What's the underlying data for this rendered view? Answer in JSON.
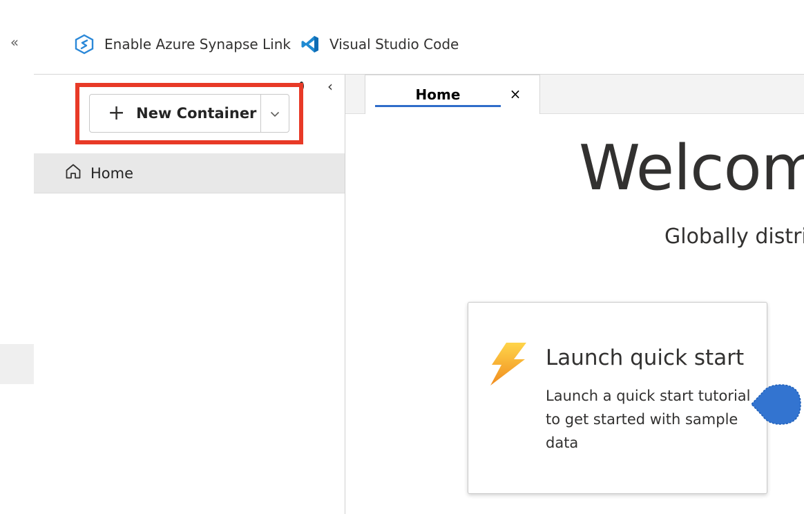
{
  "rail": {
    "collapse_glyph": "«"
  },
  "commandbar": {
    "synapse": {
      "label": "Enable Azure Synapse Link",
      "icon": "synapse-link-icon"
    },
    "vscode": {
      "label": "Visual Studio Code",
      "icon": "vscode-icon"
    }
  },
  "pane": {
    "collapse_glyph": "‹",
    "new_container": {
      "label": "New Container",
      "plus_glyph": "+",
      "split_glyph": "⌵"
    },
    "tree": {
      "home_label": "Home",
      "home_icon": "home-icon"
    }
  },
  "tabs": [
    {
      "label": "Home",
      "close_glyph": "×",
      "active": true
    }
  ],
  "main": {
    "welcome_title": "Welcome",
    "subtitle": "Globally distrib",
    "card": {
      "title": "Launch quick start",
      "description": "Launch a quick start tutorial to get started with sample data",
      "icon": "lightning-icon"
    }
  },
  "colors": {
    "accent": "#2f6cc9",
    "highlight_border": "#e83a27",
    "beacon": "#3374d0",
    "lightning": "#f3b431"
  }
}
